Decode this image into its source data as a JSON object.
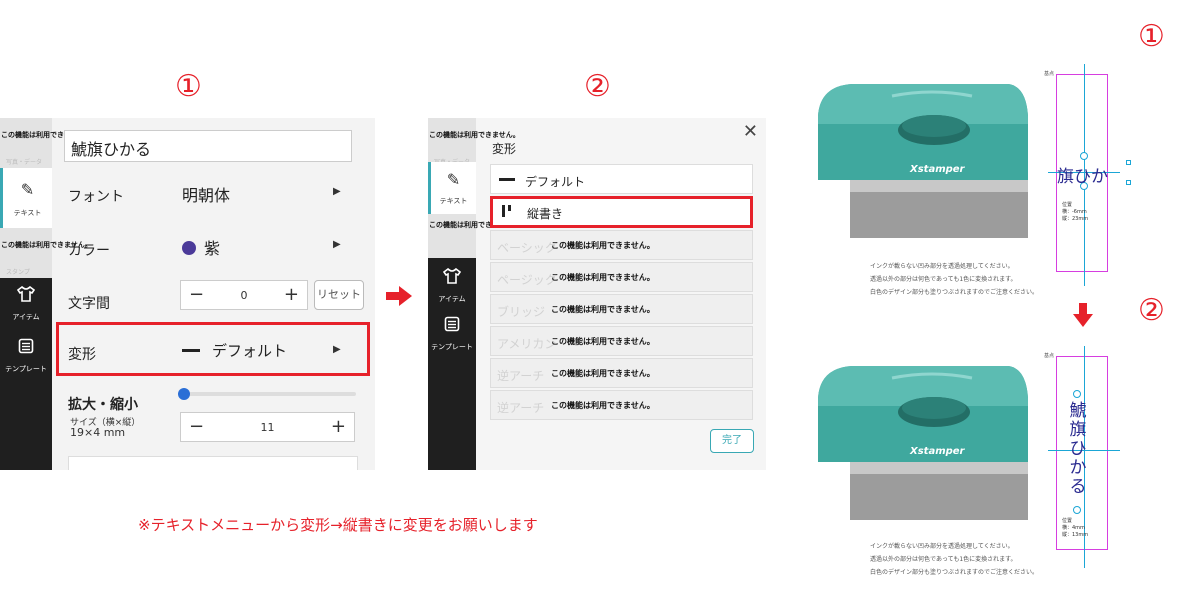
{
  "markers": {
    "one": "①",
    "two": "②"
  },
  "panel1": {
    "sidebar": {
      "disabled_notice": "この機能は利用できません。",
      "ghost_top": "写真・データ",
      "ghost_bottom": "スタンプ",
      "text_label": "テキスト",
      "item_label": "アイテム",
      "template_label": "テンプレート"
    },
    "text_value": "鯱旗ひかる",
    "font_label": "フォント",
    "font_value": "明朝体",
    "color_label": "カラー",
    "color_value": "紫",
    "color_hex": "#4b3a99",
    "spacing_label": "文字間",
    "spacing_value": "0",
    "reset_label": "リセット",
    "transform_label": "変形",
    "transform_value": "デフォルト",
    "scale_label": "拡大・縮小",
    "size_label": "サイズ（横×縦）",
    "size_value": "19×4 mm",
    "scale_value": "11",
    "scale_slider_value": 0
  },
  "panel2": {
    "title": "変形",
    "options": [
      {
        "label": "デフォルト"
      },
      {
        "label": "縦書き"
      }
    ],
    "disabled_options": [
      {
        "ghost": "ベーシック",
        "notice": "この機能は利用できません。"
      },
      {
        "ghost": "ページック",
        "notice": "この機能は利用できません。"
      },
      {
        "ghost": "ブリッジ",
        "notice": "この機能は利用できません。"
      },
      {
        "ghost": "アメリカン",
        "notice": "この機能は利用できません。"
      },
      {
        "ghost": "逆アーチ",
        "notice": "この機能は利用できません。"
      },
      {
        "ghost": "逆アーチ",
        "notice": "この機能は利用できません。"
      }
    ],
    "done_label": "完了"
  },
  "instruction": "※テキストメニューから変形→縦書きに変更をお願いします",
  "stamp": {
    "brand": "Xstamper",
    "note_lines": [
      "インクが載らない凹み部分を透過処理してください。",
      "透過以外の部分は何色であっても1色に変換されます。",
      "白色のデザイン部分も塗りつぶされますのでご注意ください。"
    ],
    "origin_label": "基点",
    "before": {
      "preview_text": "旗ひか",
      "pos_title": "位置",
      "pos_h": "横：-6mm",
      "pos_v": "縦：23mm"
    },
    "after": {
      "preview_chars": [
        "鯱",
        "旗",
        "ひ",
        "か",
        "る"
      ],
      "pos_title": "位置",
      "pos_h": "横：4mm",
      "pos_v": "縦：13mm"
    }
  },
  "colors": {
    "accent_red": "#e6212a",
    "teal": "#3fa89e",
    "guide_blue": "#1ba6d6",
    "preview_border": "#d63ee0"
  }
}
